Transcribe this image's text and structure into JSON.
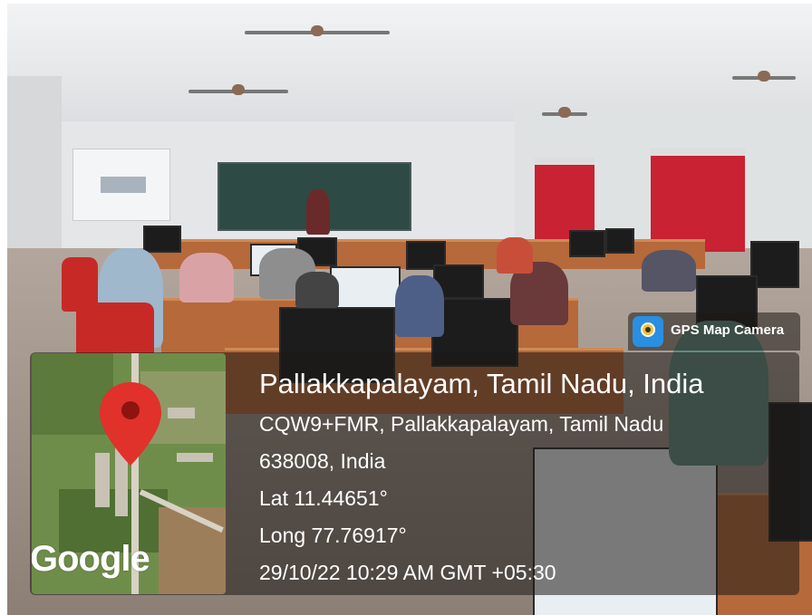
{
  "badge": {
    "label": "GPS Map Camera",
    "icon": "gps-map-camera-icon"
  },
  "location": {
    "title": "Pallakkapalayam, Tamil Nadu, India",
    "address_line1": "CQW9+FMR, Pallakkapalayam, Tamil Nadu",
    "address_line2": "638008, India",
    "latitude": "Lat 11.44651°",
    "longitude": "Long 77.76917°",
    "timestamp": "29/10/22 10:29 AM GMT +05:30"
  },
  "map": {
    "provider_logo": "Google",
    "pin_icon": "map-pin-icon",
    "pin_color": "#e0312b"
  },
  "colors": {
    "overlay": "#1e1916",
    "text": "#ffffff",
    "curtain": "#c82233",
    "desk": "#b6693a"
  }
}
